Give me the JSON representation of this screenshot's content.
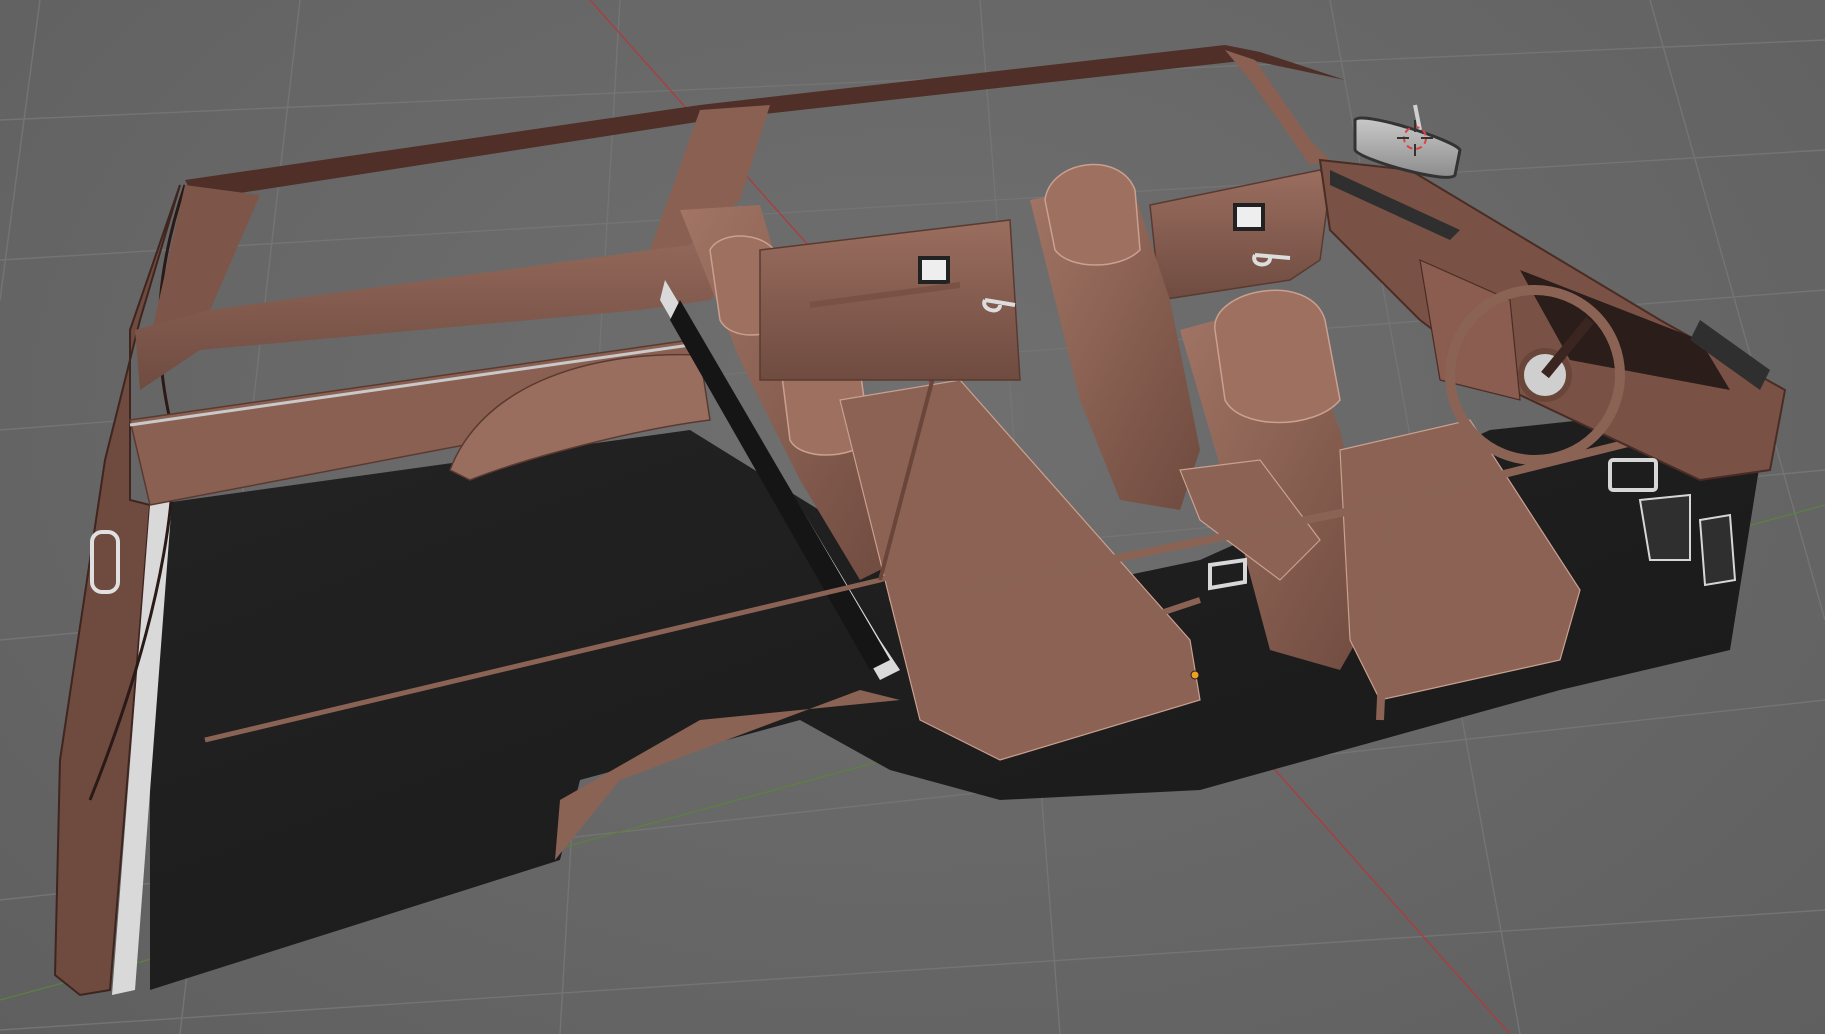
{
  "viewport": {
    "background_color": "#686868",
    "grid_color": "#737373",
    "x_axis_color": "#c23a3a",
    "y_axis_color": "#5c8a3a"
  },
  "model": {
    "trim_color": "#8b6355",
    "trim_light": "#b08676",
    "trim_dark": "#4e3028",
    "carpet_color": "#1f1f1f",
    "chrome_color": "#dcdcdc"
  },
  "icons": {
    "origin_marker": "origin-marker-icon",
    "object_cursor": "3d-cursor-icon"
  }
}
